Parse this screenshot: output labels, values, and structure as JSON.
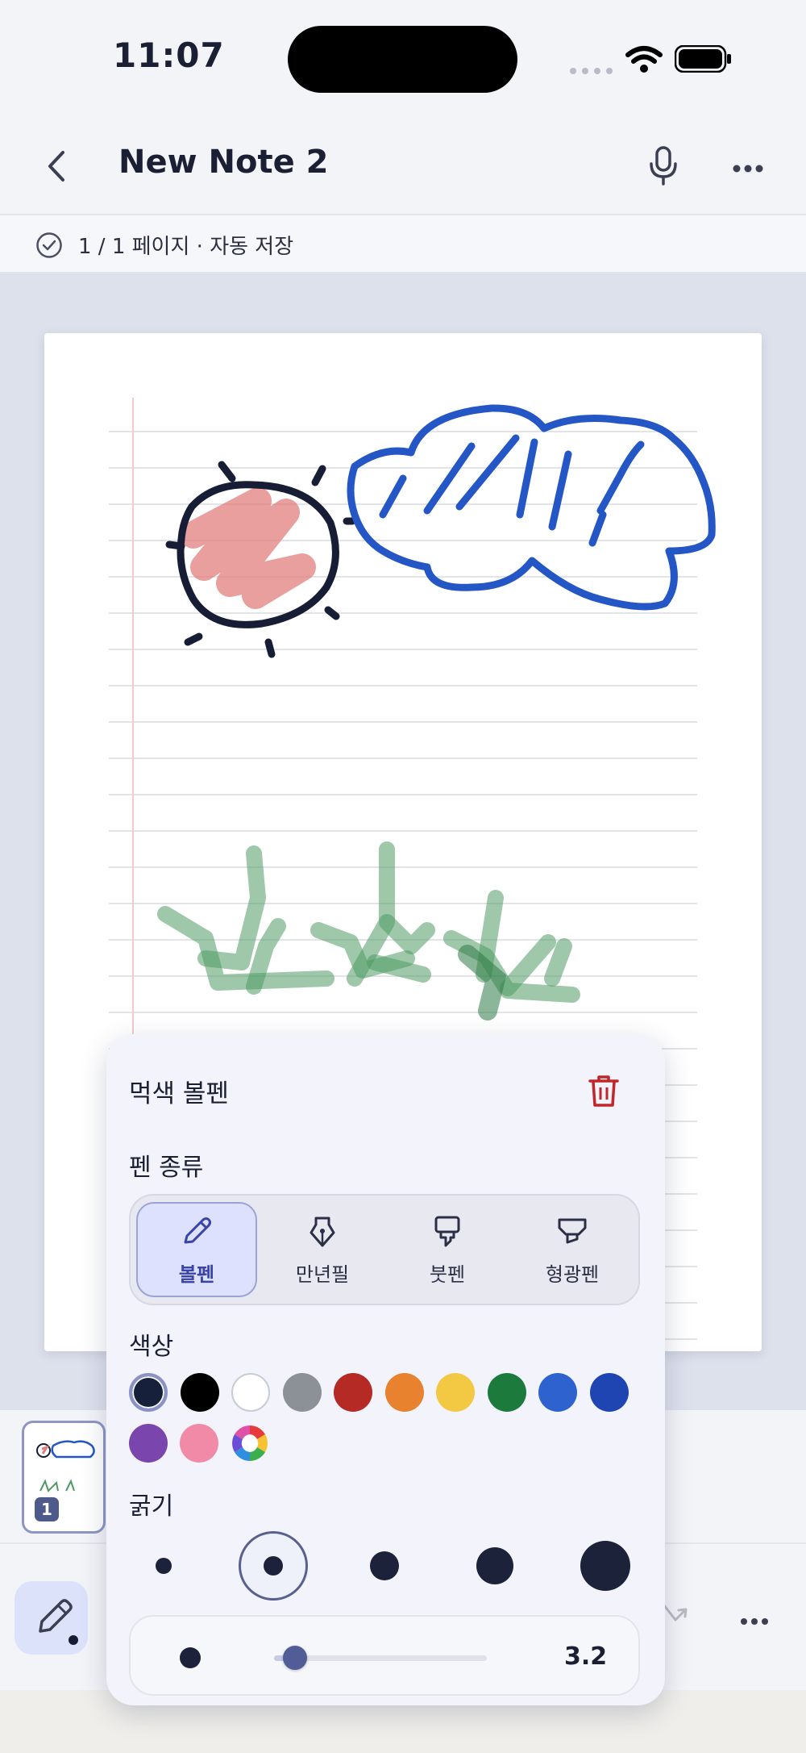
{
  "status_bar": {
    "time": "11:07"
  },
  "header": {
    "title": "New Note 2"
  },
  "subbar": {
    "save_status": "1 / 1 페이지 · 자동 저장"
  },
  "pen_panel": {
    "title": "먹색 볼펜",
    "pen_type_label": "펜 종류",
    "pen_types": [
      {
        "label": "볼펜",
        "icon": "ballpen-icon",
        "selected": true
      },
      {
        "label": "만년필",
        "icon": "fountain-pen-icon",
        "selected": false
      },
      {
        "label": "붓펜",
        "icon": "brush-pen-icon",
        "selected": false
      },
      {
        "label": "형광펜",
        "icon": "highlighter-icon",
        "selected": false
      }
    ],
    "color_label": "색상",
    "colors": [
      "#17203a",
      "#000000",
      "#ffffff",
      "#8c9097",
      "#b52a24",
      "#e8822e",
      "#f3c843",
      "#1d7a3d",
      "#2e62cf",
      "#1f45b2",
      "#7a45ad",
      "#f08aa7"
    ],
    "selected_color": "#17203a",
    "custom_color_icon": "color-wheel-icon",
    "thickness_label": "굵기",
    "thickness_options": 5,
    "selected_thickness_index": 1,
    "thickness_value": "3.2",
    "thickness_fraction": 0.1
  },
  "thumbnail": {
    "page_number": "1"
  },
  "colors": {
    "accent": "#3a44a8",
    "accent_bg": "#dde1fd",
    "trash": "#c0262a",
    "sun": "#161d35",
    "cloud": "#2457c5",
    "red_fill": "#e07f7c",
    "grass": "#4f9a63"
  }
}
